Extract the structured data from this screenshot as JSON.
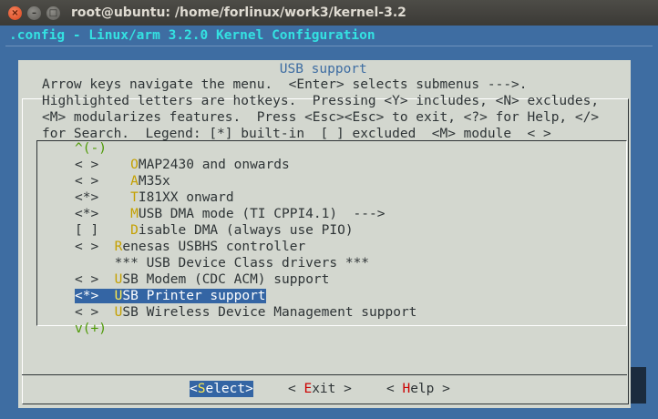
{
  "window": {
    "title": "root@ubuntu: /home/forlinux/work3/kernel-3.2",
    "close_glyph": "×",
    "min_glyph": "–",
    "max_glyph": "□"
  },
  "header": ".config - Linux/arm 3.2.0 Kernel Configuration",
  "dialog": {
    "title": " USB support ",
    "help_lines": [
      "Arrow keys navigate the menu.  <Enter> selects submenus --->.",
      "Highlighted letters are hotkeys.  Pressing <Y> includes, <N> excludes,",
      "<M> modularizes features.  Press <Esc><Esc> to exit, <?> for Help, </>",
      "for Search.  Legend: [*] built-in  [ ] excluded  <M> module  < >"
    ],
    "scroll_up": "^(-)",
    "scroll_down": "v(+)"
  },
  "menu": {
    "items": [
      {
        "prefix": "< >",
        "indent": "    ",
        "hot": "O",
        "rest": "MAP2430 and onwards"
      },
      {
        "prefix": "< >",
        "indent": "    ",
        "hot": "A",
        "rest": "M35x"
      },
      {
        "prefix": "<*>",
        "indent": "    ",
        "hot": "T",
        "rest": "I81XX onward"
      },
      {
        "prefix": "<*>",
        "indent": "    ",
        "hot": "M",
        "rest": "USB DMA mode (TI CPPI4.1)  --->"
      },
      {
        "prefix": "[ ]",
        "indent": "    ",
        "hot": "D",
        "rest": "isable DMA (always use PIO)"
      },
      {
        "prefix": "< >",
        "indent": "  ",
        "hot": "R",
        "rest": "enesas USBHS controller"
      },
      {
        "prefix": "   ",
        "indent": "  ",
        "hot": "",
        "rest": "*** USB Device Class drivers ***"
      },
      {
        "prefix": "< >",
        "indent": "  ",
        "hot": "U",
        "rest": "SB Modem (CDC ACM) support"
      },
      {
        "prefix": "<*>",
        "indent": "  ",
        "hot": "U",
        "rest": "SB Printer support"
      },
      {
        "prefix": "< >",
        "indent": "  ",
        "hot": "U",
        "rest": "SB Wireless Device Management support"
      }
    ],
    "selected_index": 8
  },
  "buttons": {
    "select": {
      "open": "<",
      "hot": "S",
      "rest": "elect",
      "close": ">"
    },
    "exit": {
      "open": "< ",
      "hot": "E",
      "rest": "xit",
      "close": " >"
    },
    "help": {
      "open": "< ",
      "hot": "H",
      "rest": "elp",
      "close": " >"
    }
  },
  "colors": {
    "terminal_bg": "#3e6da2",
    "dialog_bg": "#d3d7cf",
    "hotkey": "#c4a000",
    "selection_bg": "#3465a4",
    "scroll_indicator": "#4e9a06",
    "header_text": "#34e2e2"
  }
}
